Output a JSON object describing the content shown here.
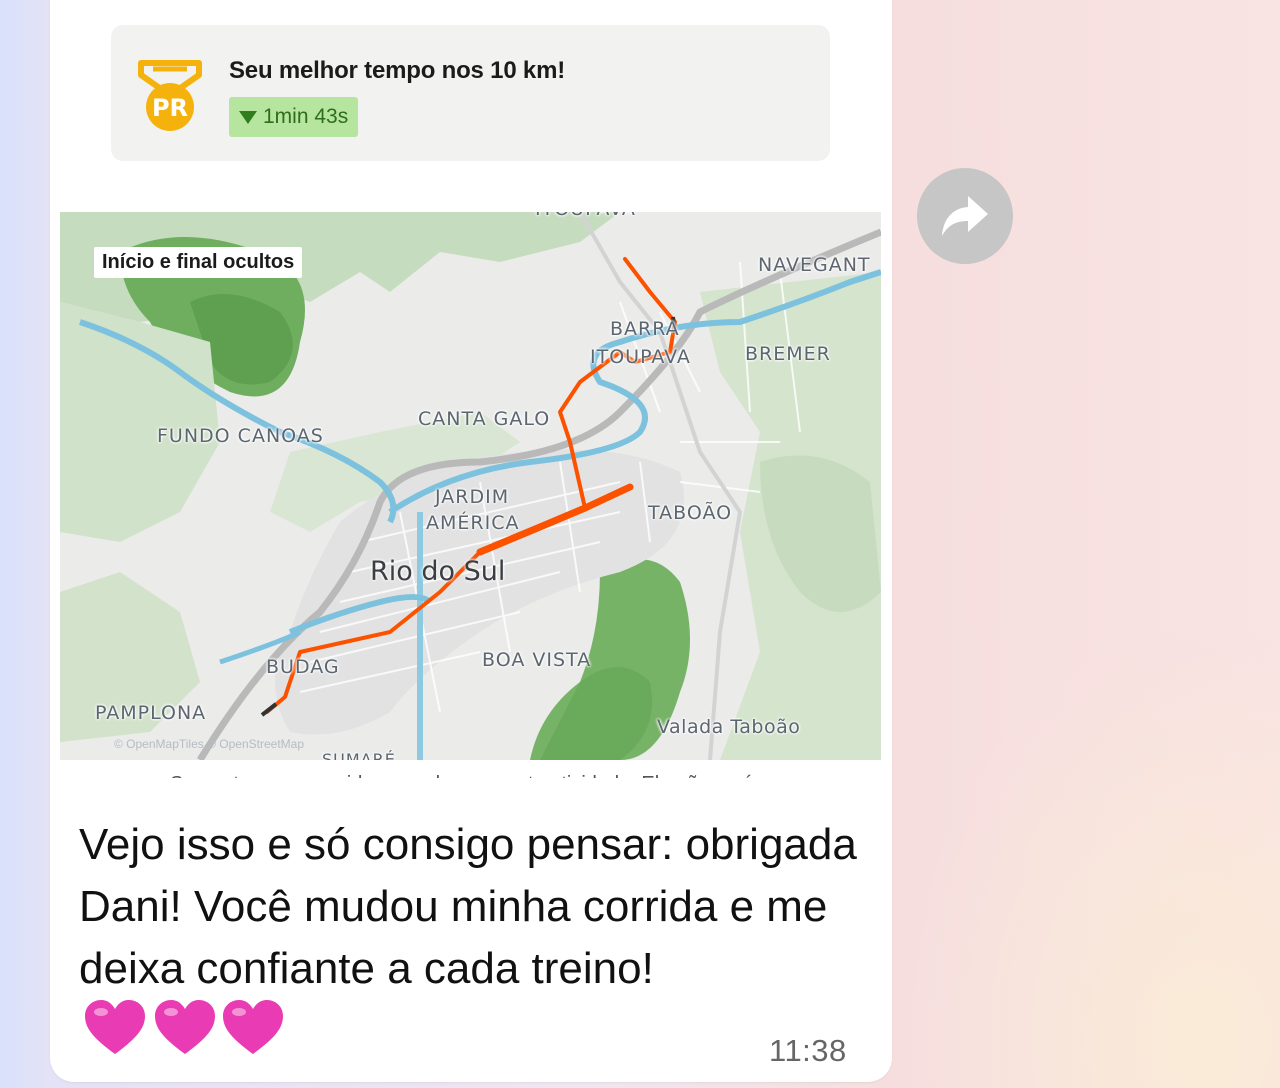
{
  "pr_card": {
    "title": "Seu melhor tempo nos 10 km!",
    "improvement": "1min 43s",
    "medal_text": "PR",
    "medal_icon": "pr-medal-icon",
    "improvement_icon": "triangle-down-icon"
  },
  "map": {
    "privacy_badge": "Início e final ocultos",
    "city": "Rio do Sul",
    "attribution": "© OpenMapTiles © OpenStreetMap",
    "labels": {
      "navegantes": "NAVEGANT",
      "barra": "BARRA",
      "itoupava": "ITOUPAVA",
      "bremer": "BREMER",
      "canta_galo": "CANTA GALO",
      "fundo_canoas": "FUNDO CANOAS",
      "jardim": "JARDIM",
      "america": "AMÉRICA",
      "taboao": "TABOÃO",
      "budag": "BUDAG",
      "boa_vista": "BOA VISTA",
      "pamplona": "PAMPLONA",
      "valada_taboao": "Valada Taboão",
      "sumare": "SUMARÉ",
      "top_cut": "ITOUPAVA"
    },
    "route_color": "#fc5200"
  },
  "cut_caption": "Somente seus seguidores podem ver esta atividade. Ela não será",
  "message": {
    "text": "Vejo isso e só consigo pensar: obrigada Dani! Você mudou minha corrida e me deixa confiante a cada treino!",
    "emoji": "💗💗💗",
    "time": "11:38"
  },
  "forward_icon": "forward-arrow-icon",
  "colors": {
    "bubble": "#ffffff",
    "badge_green": "#b6e5a0",
    "medal_gold": "#f5b20c",
    "heart_pink": "#e93bb3"
  }
}
